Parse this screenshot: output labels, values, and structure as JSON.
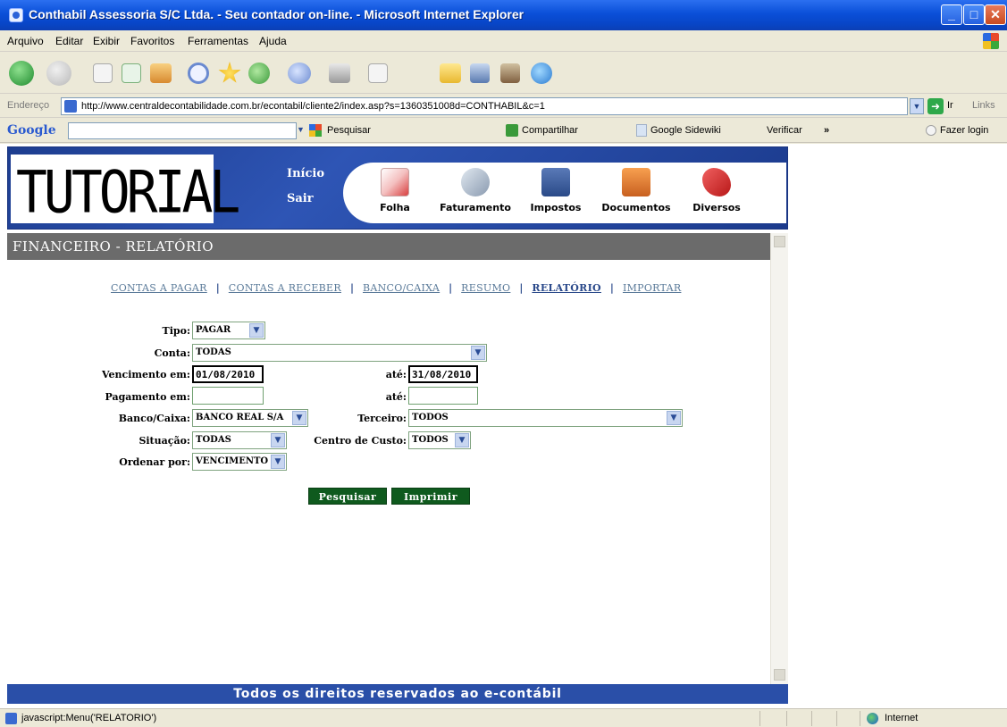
{
  "window": {
    "title": "Conthabil Assessoria S/C Ltda. - Seu contador on-line. - Microsoft Internet Explorer",
    "btn_min": "_",
    "btn_max": "□",
    "btn_close": "✕"
  },
  "menu": [
    "Arquivo",
    "Editar",
    "Exibir",
    "Favoritos",
    "Ferramentas",
    "Ajuda"
  ],
  "address": {
    "label": "Endereço",
    "url": "http://www.centraldecontabilidade.com.br/econtabil/cliente2/index.asp?s=1360351008d=CONTHABIL&c=1",
    "go": "Ir",
    "links": "Links"
  },
  "google_toolbar": {
    "logo": "Google",
    "pesquisar": "Pesquisar",
    "compartilhar": "Compartilhar",
    "sidewiki": "Google Sidewiki",
    "verificar": "Verificar",
    "more": "»",
    "login": "Fazer login"
  },
  "site": {
    "logo_text": "TUTORIAL",
    "inicio": "Início",
    "sair": "Sair",
    "nav": [
      "Folha",
      "Faturamento",
      "Impostos",
      "Documentos",
      "Diversos"
    ]
  },
  "section_title": "FINANCEIRO - RELATÓRIO",
  "tabs": [
    "CONTAS A PAGAR",
    "CONTAS A RECEBER",
    "BANCO/CAIXA",
    "RESUMO",
    "RELATÓRIO",
    "IMPORTAR"
  ],
  "tab_sep": "|",
  "form": {
    "tipo_label": "Tipo:",
    "tipo_value": "PAGAR",
    "conta_label": "Conta:",
    "conta_value": "TODAS",
    "vencimento_label": "Vencimento em:",
    "vencimento_de": "01/08/2010",
    "ate_label": "até:",
    "vencimento_ate": "31/08/2010",
    "pagamento_label": "Pagamento em:",
    "pagamento_de": "",
    "pagamento_ate": "",
    "banco_label": "Banco/Caixa:",
    "banco_value": "BANCO REAL S/A",
    "terceiro_label": "Terceiro:",
    "terceiro_value": "TODOS",
    "situacao_label": "Situação:",
    "situacao_value": "TODAS",
    "centro_label": "Centro de Custo:",
    "centro_value": "TODOS",
    "ordenar_label": "Ordenar por:",
    "ordenar_value": "VENCIMENTO",
    "pesquisar_btn": "Pesquisar",
    "imprimir_btn": "Imprimir"
  },
  "footer": "Todos os direitos reservados ao e-contábil",
  "status": {
    "text": "javascript:Menu('RELATORIO')",
    "zone": "Internet"
  },
  "colors": {
    "titlebar": "#0a4fd8",
    "header_blue": "#2e55b5",
    "section_gray": "#6b6b6b",
    "button_green": "#0f5a1e",
    "footer_blue": "#2a4fa8"
  }
}
